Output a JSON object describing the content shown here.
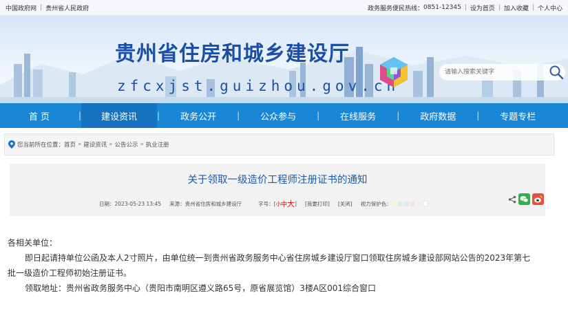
{
  "topbar": {
    "left_links": [
      "中国政府网",
      "贵州省人民政府"
    ],
    "hotline_label": "政务服务便民热线：",
    "hotline_number": "0851-12345",
    "right_links": [
      "设为首页",
      "加入收藏",
      "个人中心"
    ]
  },
  "header": {
    "title": "贵州省住房和城乡建设厅",
    "domain": "zfcxjst.guizhou.gov.cn",
    "search_placeholder": "请输入搜索关键字"
  },
  "nav": {
    "items": [
      "首 页",
      "建设资讯",
      "政务公开",
      "公众参与",
      "在线服务",
      "政府数据",
      "专题专栏"
    ],
    "active_index": 1
  },
  "breadcrumb": {
    "label": "您当前所在位置：",
    "items": [
      "首页",
      "建设资讯",
      "公告公示",
      "执业注册"
    ]
  },
  "article": {
    "title": "关于领取一级造价工程师注册证书的通知",
    "date_label": "日期：",
    "date": "2023-05-23 13:45",
    "source_label": "来源：",
    "source": "贵州省住房和城乡建设厅",
    "font_label": "字号：",
    "font_small": "小",
    "font_medium": "中",
    "font_large": "大",
    "print_label": "[我要打印]",
    "close_label": "[关闭]",
    "eye_label": "视力保护色：",
    "eye_colors": [
      "#f7f4c8",
      "#d9f0d9",
      "#e3e8f7",
      "#f3e0ef",
      "#eeeeee",
      "#ffffff"
    ],
    "body": [
      "各相关单位：",
      "即日起请持单位公函及本人2寸照片，由单位统一到贵州省政务服务中心省住房城乡建设厅窗口领取住房城乡建设部网站公告的2023年第七",
      "批一级造价工程师初始注册证书。",
      "领取地址：贵州省政务服务中心（贵阳市南明区遵义路65号，原省展览馆）3楼A区001综合窗口"
    ]
  },
  "colors": {
    "nav_bg": "#1987d6",
    "nav_active": "#1673bf",
    "title_blue": "#1a4fa8",
    "wechat": "#2db24a",
    "weibo": "#e6533b"
  }
}
